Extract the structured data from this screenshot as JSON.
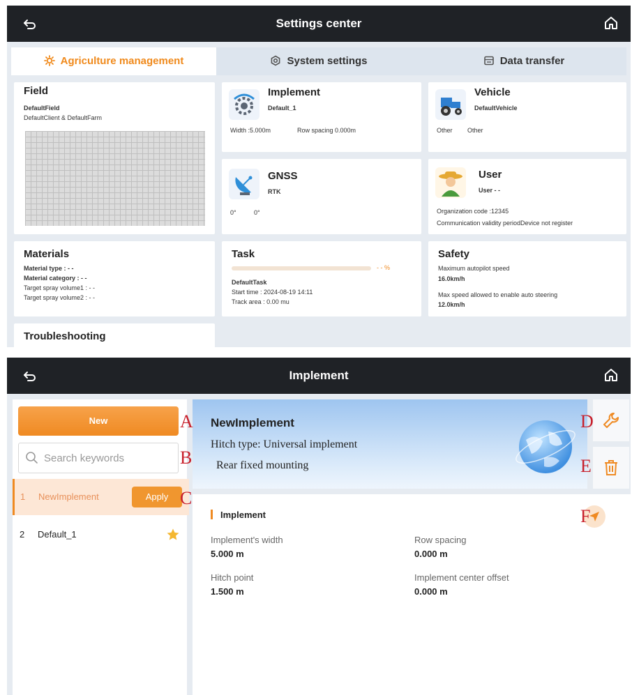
{
  "screen1": {
    "title": "Settings center",
    "tabs": [
      {
        "label": "Agriculture management",
        "icon": "gear-sun-icon"
      },
      {
        "label": "System settings",
        "icon": "gear-icon"
      },
      {
        "label": "Data transfer",
        "icon": "storage-icon"
      }
    ],
    "field": {
      "title": "Field",
      "name": "DefaultField",
      "owner": "DefaultClient & DefaultFarm"
    },
    "implement": {
      "title": "Implement",
      "name": "Default_1",
      "width": "Width :5.000m",
      "row_spacing": "Row spacing 0.000m"
    },
    "vehicle": {
      "title": "Vehicle",
      "name": "DefaultVehicle",
      "info1": "Other",
      "info2": "Other"
    },
    "gnss": {
      "title": "GNSS",
      "mode": "RTK",
      "lat": "0°",
      "lon": "0°"
    },
    "user": {
      "title": "User",
      "name": "User - -",
      "org_code": "Organization code :12345",
      "validity": "Communication validity periodDevice not register"
    },
    "materials": {
      "title": "Materials",
      "type": "Material type : - -",
      "category": "Material category : - -",
      "spray1": "Target spray volume1 : - -",
      "spray2": "Target spray volume2 : - -"
    },
    "task": {
      "title": "Task",
      "progress_label": "- - %",
      "name": "DefaultTask",
      "start_time": "Start time : 2024-08-19 14:11",
      "track_area": "Track area : 0.00 mu",
      "progress": 0
    },
    "safety": {
      "title": "Safety",
      "max_speed_label": "Maximum autopilot speed",
      "max_speed": "16.0km/h",
      "auto_steer_label": "Max speed allowed to enable auto steering",
      "auto_steer_speed": "12.0km/h"
    },
    "troubleshooting": {
      "title": "Troubleshooting"
    }
  },
  "screen2": {
    "title": "Implement",
    "new_button": "New",
    "search_placeholder": "Search keywords",
    "list": [
      {
        "index": "1",
        "name": "NewImplement",
        "apply": "Apply",
        "selected": true
      },
      {
        "index": "2",
        "name": "Default_1",
        "favorite": true
      }
    ],
    "banner": {
      "name": "NewImplement",
      "hitch_type": "Hitch type:  Universal implement",
      "mounting": "Rear fixed mounting"
    },
    "section_title": "Implement",
    "fields": {
      "width_label": "Implement's width",
      "width_value": "5.000 m",
      "row_label": "Row spacing",
      "row_value": "0.000 m",
      "hitch_label": "Hitch point",
      "hitch_value": "1.500 m",
      "offset_label": "Implement center offset",
      "offset_value": "0.000 m"
    },
    "markers": {
      "a": "A",
      "b": "B",
      "c": "C",
      "d": "D",
      "e": "E",
      "f": "F"
    }
  },
  "colors": {
    "accent": "#ef8a22",
    "link_blue": "#1f5fd6",
    "topbar": "#1f2226",
    "marker": "#c8202c"
  }
}
